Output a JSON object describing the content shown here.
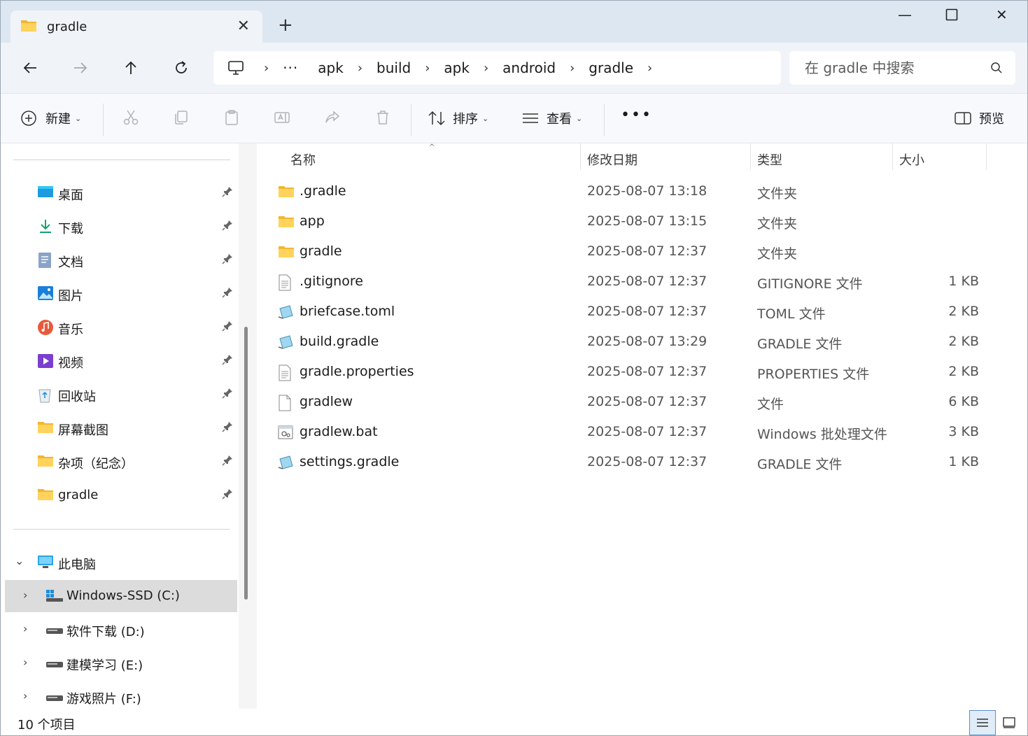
{
  "tab": {
    "title": "gradle"
  },
  "breadcrumbs": [
    "apk",
    "build",
    "apk",
    "android",
    "gradle"
  ],
  "search": {
    "placeholder": "在 gradle 中搜索"
  },
  "toolbar": {
    "new_label": "新建",
    "sort_label": "排序",
    "view_label": "查看",
    "preview_label": "预览"
  },
  "sidebar": {
    "quick_access": [
      {
        "label": "桌面",
        "icon": "desktop-icon"
      },
      {
        "label": "下载",
        "icon": "download-icon"
      },
      {
        "label": "文档",
        "icon": "documents-icon"
      },
      {
        "label": "图片",
        "icon": "pictures-icon"
      },
      {
        "label": "音乐",
        "icon": "music-icon"
      },
      {
        "label": "视频",
        "icon": "videos-icon"
      },
      {
        "label": "回收站",
        "icon": "recycle-bin-icon"
      },
      {
        "label": "屏幕截图",
        "icon": "folder-icon"
      },
      {
        "label": "杂项（纪念）",
        "icon": "folder-icon"
      },
      {
        "label": "gradle",
        "icon": "folder-icon"
      }
    ],
    "this_pc": "此电脑",
    "drives": [
      {
        "label": "Windows-SSD (C:)"
      },
      {
        "label": "软件下载 (D:)"
      },
      {
        "label": "建模学习 (E:)"
      },
      {
        "label": "游戏照片 (F:)"
      }
    ]
  },
  "columns": {
    "name": "名称",
    "modified": "修改日期",
    "type": "类型",
    "size": "大小"
  },
  "files": [
    {
      "name": ".gradle",
      "date": "2025-08-07 13:18",
      "type": "文件夹",
      "size": "",
      "icon": "folder"
    },
    {
      "name": "app",
      "date": "2025-08-07 13:15",
      "type": "文件夹",
      "size": "",
      "icon": "folder"
    },
    {
      "name": "gradle",
      "date": "2025-08-07 12:37",
      "type": "文件夹",
      "size": "",
      "icon": "folder"
    },
    {
      "name": ".gitignore",
      "date": "2025-08-07 12:37",
      "type": "GITIGNORE 文件",
      "size": "1 KB",
      "icon": "text"
    },
    {
      "name": "briefcase.toml",
      "date": "2025-08-07 12:37",
      "type": "TOML 文件",
      "size": "2 KB",
      "icon": "editor"
    },
    {
      "name": "build.gradle",
      "date": "2025-08-07 13:29",
      "type": "GRADLE 文件",
      "size": "2 KB",
      "icon": "editor"
    },
    {
      "name": "gradle.properties",
      "date": "2025-08-07 12:37",
      "type": "PROPERTIES 文件",
      "size": "2 KB",
      "icon": "text"
    },
    {
      "name": "gradlew",
      "date": "2025-08-07 12:37",
      "type": "文件",
      "size": "6 KB",
      "icon": "blank"
    },
    {
      "name": "gradlew.bat",
      "date": "2025-08-07 12:37",
      "type": "Windows 批处理文件",
      "size": "3 KB",
      "icon": "batch"
    },
    {
      "name": "settings.gradle",
      "date": "2025-08-07 12:37",
      "type": "GRADLE 文件",
      "size": "1 KB",
      "icon": "editor"
    }
  ],
  "status": {
    "item_count": "10 个项目"
  }
}
